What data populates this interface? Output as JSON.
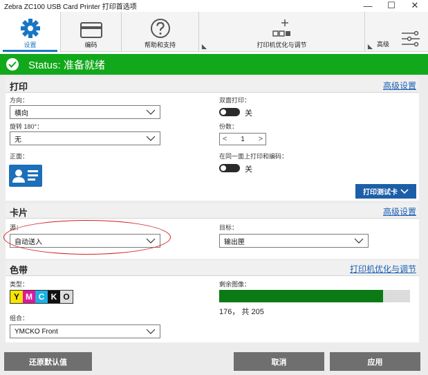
{
  "window": {
    "title": "Zebra ZC100 USB Card Printer 打印首选项",
    "minimize": "—",
    "maximize": "☐",
    "close": "✕"
  },
  "toolbar": {
    "items": [
      {
        "label": "设置",
        "icon": "gear-icon",
        "active": true
      },
      {
        "label": "编码",
        "icon": "card-icon"
      },
      {
        "label": "帮助和支持",
        "icon": "question-icon"
      },
      {
        "label": "打印机优化与调节",
        "icon": "printer-optimize-icon"
      },
      {
        "label": "高级",
        "icon": "sliders-icon"
      }
    ]
  },
  "status": {
    "text": "Status: 准备就绪",
    "color": "#12a81b"
  },
  "print_section": {
    "title": "打印",
    "link": "高级设置",
    "orientation_label": "方向：",
    "orientation_value": "横向",
    "rotate_label": "旋转 180°：",
    "rotate_value": "无",
    "front_label": "正面：",
    "duplex_label": "双面打印：",
    "duplex_value": "关",
    "copies_label": "份数：",
    "copies_value": "1",
    "same_side_label": "在同一面上打印和编码：",
    "same_side_value": "关",
    "test_card_button": "打印测试卡"
  },
  "card_section": {
    "title": "卡片",
    "link": "高级设置",
    "source_label": "源：",
    "source_value": "自动送入",
    "target_label": "目标：",
    "target_value": "输出匣"
  },
  "ribbon_section": {
    "title": "色带",
    "link": "打印机优化与调节",
    "type_label": "类型：",
    "ymcko": [
      "Y",
      "M",
      "C",
      "K",
      "O"
    ],
    "combo_label": "组合：",
    "combo_value": "YMCKO Front",
    "remaining_label": "剩余图像：",
    "remaining_text": "176， 共 205",
    "remaining_value": 176,
    "remaining_total": 205
  },
  "footer": {
    "reset_button": "还原默认值",
    "cancel_button": "取消",
    "apply_button": "应用"
  },
  "colors": {
    "accent_blue": "#1976c2",
    "link_blue": "#1a5fb4",
    "status_green": "#12a81b",
    "progress_green": "#0b7a15",
    "highlight_red": "#d21f1f",
    "yellow": "#f6e500",
    "magenta": "#e0189a",
    "cyan": "#1cb1e6",
    "black": "#111111",
    "overlay_gray": "#dddddd"
  }
}
